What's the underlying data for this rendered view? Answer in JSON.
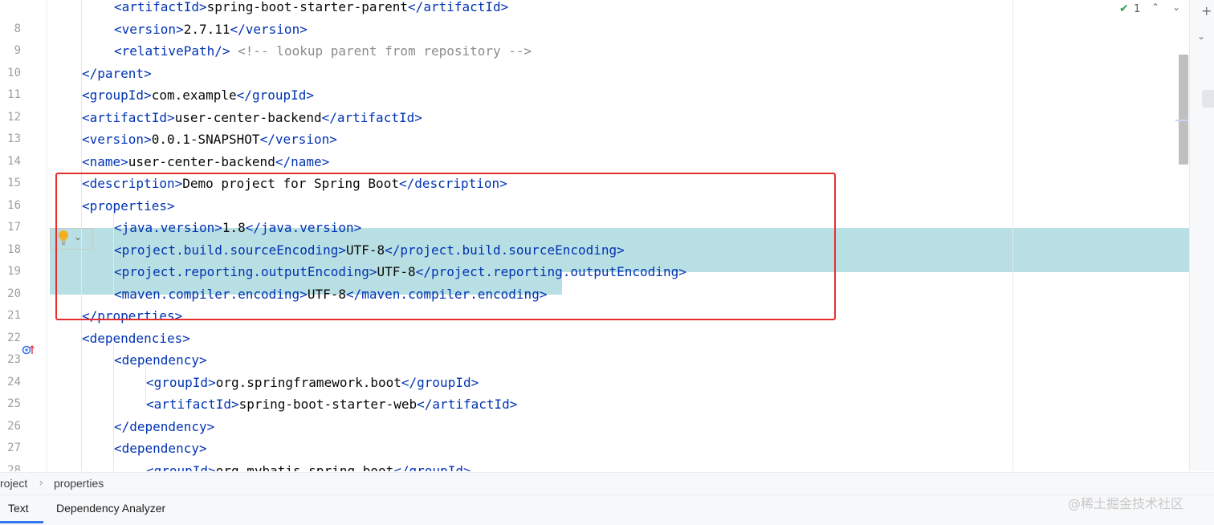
{
  "editor": {
    "lines": [
      {
        "num": "",
        "indent": 2,
        "parts": [
          [
            "tag",
            "<artifactId>"
          ],
          [
            "txt",
            "spring-boot-starter-parent"
          ],
          [
            "tag",
            "</artifactId>"
          ]
        ]
      },
      {
        "num": "8",
        "indent": 2,
        "parts": [
          [
            "tag",
            "<version>"
          ],
          [
            "txt",
            "2.7.11"
          ],
          [
            "tag",
            "</version>"
          ]
        ]
      },
      {
        "num": "9",
        "indent": 2,
        "parts": [
          [
            "tag",
            "<relativePath/>"
          ],
          [
            "txt",
            " "
          ],
          [
            "comment",
            "<!-- lookup parent from repository -->"
          ]
        ]
      },
      {
        "num": "10",
        "indent": 1,
        "parts": [
          [
            "tag",
            "</parent>"
          ]
        ]
      },
      {
        "num": "11",
        "indent": 1,
        "parts": [
          [
            "tag",
            "<groupId>"
          ],
          [
            "txt",
            "com.example"
          ],
          [
            "tag",
            "</groupId>"
          ]
        ]
      },
      {
        "num": "12",
        "indent": 1,
        "parts": [
          [
            "tag",
            "<artifactId>"
          ],
          [
            "txt",
            "user-center-backend"
          ],
          [
            "tag",
            "</artifactId>"
          ]
        ]
      },
      {
        "num": "13",
        "indent": 1,
        "parts": [
          [
            "tag",
            "<version>"
          ],
          [
            "txt",
            "0.0.1-SNAPSHOT"
          ],
          [
            "tag",
            "</version>"
          ]
        ]
      },
      {
        "num": "14",
        "indent": 1,
        "parts": [
          [
            "tag",
            "<name>"
          ],
          [
            "txt",
            "user-center-backend"
          ],
          [
            "tag",
            "</name>"
          ]
        ]
      },
      {
        "num": "15",
        "indent": 1,
        "parts": [
          [
            "tag",
            "<description>"
          ],
          [
            "txt",
            "Demo project for Spring Boot"
          ],
          [
            "tag",
            "</description>"
          ]
        ]
      },
      {
        "num": "16",
        "indent": 1,
        "parts": [
          [
            "tag",
            "<properties>"
          ]
        ]
      },
      {
        "num": "17",
        "indent": 2,
        "parts": [
          [
            "tag",
            "<java.version>"
          ],
          [
            "txt",
            "1.8"
          ],
          [
            "tag",
            "</java.version>"
          ]
        ]
      },
      {
        "num": "18",
        "indent": 2,
        "parts": [
          [
            "tag",
            "<project.build.sourceEncoding>"
          ],
          [
            "txt",
            "UTF-8"
          ],
          [
            "tag",
            "</project.build.sourceEncoding>"
          ]
        ]
      },
      {
        "num": "19",
        "indent": 2,
        "parts": [
          [
            "tag",
            "<project.reporting.outputEncoding>"
          ],
          [
            "txt",
            "UTF-8"
          ],
          [
            "tag",
            "</project.reporting.outputEncoding>"
          ]
        ]
      },
      {
        "num": "20",
        "indent": 2,
        "parts": [
          [
            "tag",
            "<maven.compiler.encoding>"
          ],
          [
            "txt",
            "UTF-8"
          ],
          [
            "tag",
            "</maven.compiler.encoding>"
          ]
        ]
      },
      {
        "num": "21",
        "indent": 1,
        "parts": [
          [
            "tag",
            "</properties>"
          ]
        ]
      },
      {
        "num": "22",
        "indent": 1,
        "parts": [
          [
            "tag",
            "<dependencies>"
          ]
        ]
      },
      {
        "num": "23",
        "indent": 2,
        "parts": [
          [
            "tag",
            "<dependency>"
          ]
        ]
      },
      {
        "num": "24",
        "indent": 3,
        "parts": [
          [
            "tag",
            "<groupId>"
          ],
          [
            "txt",
            "org.springframework.boot"
          ],
          [
            "tag",
            "</groupId>"
          ]
        ]
      },
      {
        "num": "25",
        "indent": 3,
        "parts": [
          [
            "tag",
            "<artifactId>"
          ],
          [
            "txt",
            "spring-boot-starter-web"
          ],
          [
            "tag",
            "</artifactId>"
          ]
        ]
      },
      {
        "num": "26",
        "indent": 2,
        "parts": [
          [
            "tag",
            "</dependency>"
          ]
        ]
      },
      {
        "num": "27",
        "indent": 2,
        "parts": [
          [
            "tag",
            "<dependency>"
          ]
        ]
      },
      {
        "num": "28",
        "indent": 3,
        "parts": [
          [
            "tag",
            "<groupId>"
          ],
          [
            "txt",
            "org.mybatis.spring.boot"
          ],
          [
            "tag",
            "</groupId>"
          ]
        ]
      }
    ]
  },
  "inspection": {
    "count": "1",
    "up_icon": "chevron-up-icon",
    "down_icon": "chevron-down-icon"
  },
  "breadcrumb": {
    "items": [
      "roject",
      "properties"
    ],
    "separator": "›"
  },
  "bottom_tabs": {
    "text": "Text",
    "dependency_analyzer": "Dependency Analyzer"
  },
  "watermark": "@稀土掘金技术社区",
  "colors": {
    "tag": "#0033b3",
    "highlight": "#b8dfe3",
    "annotation_box": "#e52e2e",
    "accent": "#3574f0"
  }
}
